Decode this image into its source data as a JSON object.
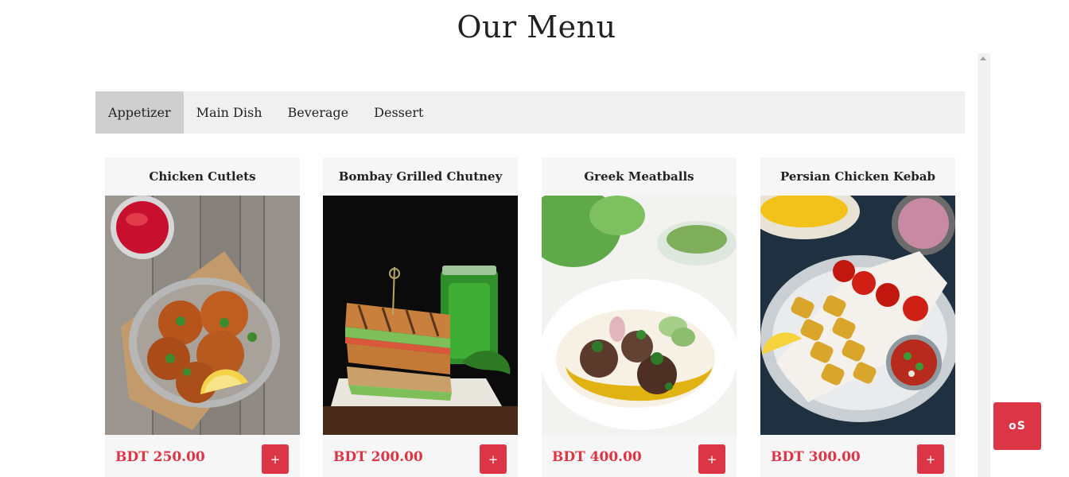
{
  "page": {
    "title": "Our Menu"
  },
  "tabs": [
    {
      "label": "Appetizer",
      "active": true
    },
    {
      "label": "Main Dish",
      "active": false
    },
    {
      "label": "Beverage",
      "active": false
    },
    {
      "label": "Dessert",
      "active": false
    }
  ],
  "items": [
    {
      "name": "Chicken Cutlets",
      "price": "BDT 250.00",
      "add_label": "+",
      "image": "chicken-cutlets-photo"
    },
    {
      "name": "Bombay Grilled Chutney",
      "price": "BDT 200.00",
      "add_label": "+",
      "image": "grilled-sandwich-photo"
    },
    {
      "name": "Greek Meatballs",
      "price": "BDT 400.00",
      "add_label": "+",
      "image": "meatballs-photo"
    },
    {
      "name": "Persian Chicken Kebab",
      "price": "BDT 300.00",
      "add_label": "+",
      "image": "kebab-photo"
    }
  ],
  "floating_button": {
    "label": "oS"
  },
  "colors": {
    "accent": "#dc3545",
    "tab_bar": "#f0f0f0",
    "tab_active": "#cfcfcf",
    "card_bg": "#f6f6f6"
  }
}
